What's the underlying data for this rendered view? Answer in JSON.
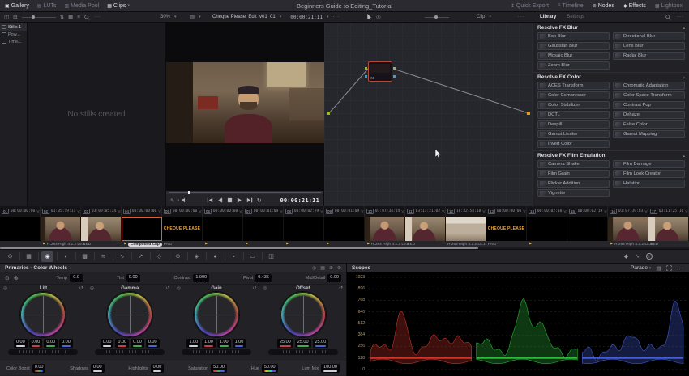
{
  "top_bar": {
    "title": "Beginners Guide to Editing_Tutorial",
    "left": [
      {
        "label": "Gallery",
        "icon": "gallery-icon",
        "glyph": "▣",
        "active": true,
        "caret": false
      },
      {
        "label": "LUTs",
        "icon": "luts-icon",
        "glyph": "▤",
        "active": false,
        "caret": false
      },
      {
        "label": "Media Pool",
        "icon": "media-pool-icon",
        "glyph": "▥",
        "active": false,
        "caret": false
      },
      {
        "label": "Clips",
        "icon": "clips-icon",
        "glyph": "▦",
        "active": true,
        "caret": true
      }
    ],
    "right": [
      {
        "label": "Quick Export",
        "icon": "quick-export-icon",
        "glyph": "↥",
        "active": false
      },
      {
        "label": "Timeline",
        "icon": "timeline-icon",
        "glyph": "≡",
        "active": false
      },
      {
        "label": "Nodes",
        "icon": "nodes-icon",
        "glyph": "⊚",
        "active": true
      },
      {
        "label": "Effects",
        "icon": "effects-icon",
        "glyph": "◆",
        "active": true
      },
      {
        "label": "Lightbox",
        "icon": "lightbox-icon",
        "glyph": "▦",
        "active": false
      }
    ]
  },
  "gallery": {
    "albums": [
      {
        "label": "Stills 1",
        "active": true
      },
      {
        "label": "Pow...",
        "active": false
      },
      {
        "label": "Time...",
        "active": false
      }
    ],
    "zoom_level": "30%",
    "empty_text": "No stills created"
  },
  "viewer": {
    "clip_name": "Cheque Please_Edit_v01_01",
    "header_timecode": "00:00:21:11",
    "transport_timecode": "00:00:21:11",
    "playhead_pct": 14
  },
  "node_graph": {
    "view_label": "Clip",
    "node_label": "01"
  },
  "library": {
    "tabs": [
      {
        "label": "Library",
        "active": true
      },
      {
        "label": "Settings",
        "active": false
      }
    ],
    "sections": [
      {
        "title": "Resolve FX Blur",
        "items": [
          "Box Blur",
          "Directional Blur",
          "Gaussian Blur",
          "Lens Blur",
          "Mosaic Blur",
          "Radial Blur",
          "Zoom Blur"
        ]
      },
      {
        "title": "Resolve FX Color",
        "items": [
          "ACES Transform",
          "Chromatic Adaptation",
          "Color Compressor",
          "Color Space Transform",
          "Color Stabilizer",
          "Contrast Pop",
          "DCTL",
          "Dehaze",
          "Despill",
          "False Color",
          "Gamut Limiter",
          "Gamut Mapping",
          "Invert Color"
        ]
      },
      {
        "title": "Resolve FX Film Emulation",
        "items": [
          "Camera Shake",
          "Film Damage",
          "Film Grain",
          "Film Look Creator",
          "Flicker Addition",
          "Halation",
          "Vignette"
        ]
      }
    ]
  },
  "timeline": {
    "cheque_text": "CHEQUE PLEASE",
    "clips": [
      {
        "num": "01",
        "tc": "00:00:00:00",
        "track": "V1",
        "thumb": "black",
        "label": "",
        "flag": false,
        "selected": false
      },
      {
        "num": "02",
        "tc": "01:05:19:11",
        "track": "V1",
        "thumb": "man-a",
        "label": "H.264 High 4:2:2 L5.1",
        "flag": true,
        "selected": false
      },
      {
        "num": "03",
        "tc": "03:09:05:24",
        "track": "V2",
        "thumb": "man-b",
        "label": "RED",
        "flag": false,
        "selected": false
      },
      {
        "num": "04",
        "tc": "00:00:00:00",
        "track": "V1",
        "thumb": "black",
        "label": "Compound Clip",
        "flag": true,
        "selected": true
      },
      {
        "num": "05",
        "tc": "00:00:00:00",
        "track": "V1",
        "thumb": "cheque",
        "label": "PNG",
        "flag": false,
        "selected": false
      },
      {
        "num": "06",
        "tc": "00:00:00:00",
        "track": "V1",
        "thumb": "black",
        "label": "",
        "flag": true,
        "selected": false
      },
      {
        "num": "07",
        "tc": "00:00:01:09",
        "track": "V1",
        "thumb": "black",
        "label": "",
        "flag": true,
        "selected": false
      },
      {
        "num": "08",
        "tc": "00:00:02:29",
        "track": "V1",
        "thumb": "black",
        "label": "",
        "flag": true,
        "selected": false
      },
      {
        "num": "09",
        "tc": "00:00:01:09",
        "track": "V1",
        "thumb": "black",
        "label": "",
        "flag": true,
        "selected": false
      },
      {
        "num": "10",
        "tc": "01:07:34:14",
        "track": "V1",
        "thumb": "man-a",
        "label": "H.264 High 4:2:2 L5.1",
        "flag": true,
        "selected": false
      },
      {
        "num": "11",
        "tc": "03:11:21:02",
        "track": "V2",
        "thumb": "man-b",
        "label": "RED",
        "flag": false,
        "selected": false
      },
      {
        "num": "12",
        "tc": "18:32:54:18",
        "track": "V1",
        "thumb": "outdoor",
        "label": "H.264 High 4:2:2 L5.1",
        "flag": false,
        "selected": false
      },
      {
        "num": "13",
        "tc": "00:00:00:00",
        "track": "V1",
        "thumb": "cheque",
        "label": "PNG",
        "flag": false,
        "selected": false
      },
      {
        "num": "14",
        "tc": "00:00:02:10",
        "track": "V1",
        "thumb": "black",
        "label": "",
        "flag": true,
        "selected": false
      },
      {
        "num": "15",
        "tc": "00:00:02:19",
        "track": "V1",
        "thumb": "black",
        "label": "",
        "flag": false,
        "selected": false
      },
      {
        "num": "16",
        "tc": "01:07:39:03",
        "track": "V1",
        "thumb": "man-a",
        "label": "H.264 High 4:2:2 L5.1",
        "flag": true,
        "selected": false
      },
      {
        "num": "17",
        "tc": "03:11:25:16",
        "track": "V1",
        "thumb": "man-b",
        "label": "RED",
        "flag": false,
        "selected": false
      }
    ]
  },
  "toolbar": {
    "left_icons": [
      {
        "name": "camera-raw-icon",
        "glyph": "⊙",
        "active": false
      },
      {
        "name": "color-match-icon",
        "glyph": "▦",
        "active": false
      },
      {
        "name": "color-wheels-icon",
        "glyph": "◉",
        "active": true
      },
      {
        "name": "hdr-wheels-icon",
        "glyph": "◐",
        "active": false
      },
      {
        "name": "rgb-mixer-icon",
        "glyph": "▩",
        "active": false
      },
      {
        "name": "motion-effects-icon",
        "glyph": "≋",
        "active": false
      },
      {
        "name": "curves-icon",
        "glyph": "∿",
        "active": false
      },
      {
        "name": "qualifier-icon",
        "glyph": "↗",
        "active": false
      },
      {
        "name": "power-windows-icon",
        "glyph": "◇",
        "active": false
      },
      {
        "name": "tracker-icon",
        "glyph": "⊕",
        "active": false
      },
      {
        "name": "magic-mask-icon",
        "glyph": "◈",
        "active": false
      },
      {
        "name": "blur-icon",
        "glyph": "●",
        "active": false
      },
      {
        "name": "key-icon",
        "glyph": "▪",
        "active": false
      },
      {
        "name": "sizing-icon",
        "glyph": "▭",
        "active": false
      },
      {
        "name": "stereo-3d-icon",
        "glyph": "◫",
        "active": false
      }
    ],
    "right_icons": [
      {
        "name": "keyframes-icon",
        "glyph": "◆"
      },
      {
        "name": "scopes-icon",
        "glyph": "∿"
      }
    ]
  },
  "wheels_panel": {
    "title": "Primaries - Color Wheels",
    "header_icons": [
      {
        "name": "target-icon",
        "glyph": "◎"
      },
      {
        "name": "stills-icon",
        "glyph": "▤"
      },
      {
        "name": "zoom-icon",
        "glyph": "⊕"
      },
      {
        "name": "settings-wheel-icon",
        "glyph": "⊛"
      }
    ],
    "adjustments": [
      {
        "label": "Temp",
        "value": "0.0",
        "underline": "temp"
      },
      {
        "label": "Tint",
        "value": "0.00",
        "underline": "tint"
      },
      {
        "label": "Contrast",
        "value": "1.000",
        "underline": "white"
      },
      {
        "label": "Pivot",
        "value": "0.435",
        "underline": "white"
      },
      {
        "label": "Mid/Detail",
        "value": "0.00",
        "underline": "white"
      }
    ],
    "wheels": [
      {
        "name": "Lift",
        "values": [
          "0.00",
          "0.00",
          "0.00",
          "0.00"
        ]
      },
      {
        "name": "Gamma",
        "values": [
          "0.00",
          "0.00",
          "0.00",
          "0.00"
        ]
      },
      {
        "name": "Gain",
        "values": [
          "1.00",
          "1.00",
          "1.00",
          "1.00"
        ]
      },
      {
        "name": "Offset",
        "values": [
          "25.00",
          "25.00",
          "25.00"
        ]
      }
    ],
    "bottom": [
      {
        "label": "Color Boost",
        "value": "0.00",
        "underline": "rgb"
      },
      {
        "label": "Shadows",
        "value": "0.00",
        "underline": "white"
      },
      {
        "label": "Highlights",
        "value": "0.00",
        "underline": "white"
      },
      {
        "label": "Saturation",
        "value": "50.00",
        "underline": "rgb"
      },
      {
        "label": "Hue",
        "value": "50.00",
        "underline": "rainbow"
      },
      {
        "label": "Lum Mix",
        "value": "100.00",
        "underline": "white"
      }
    ]
  },
  "scopes": {
    "title": "Scopes",
    "mode": "Parade",
    "axis_values": [
      1023,
      896,
      768,
      640,
      512,
      384,
      256,
      128,
      0
    ]
  }
}
